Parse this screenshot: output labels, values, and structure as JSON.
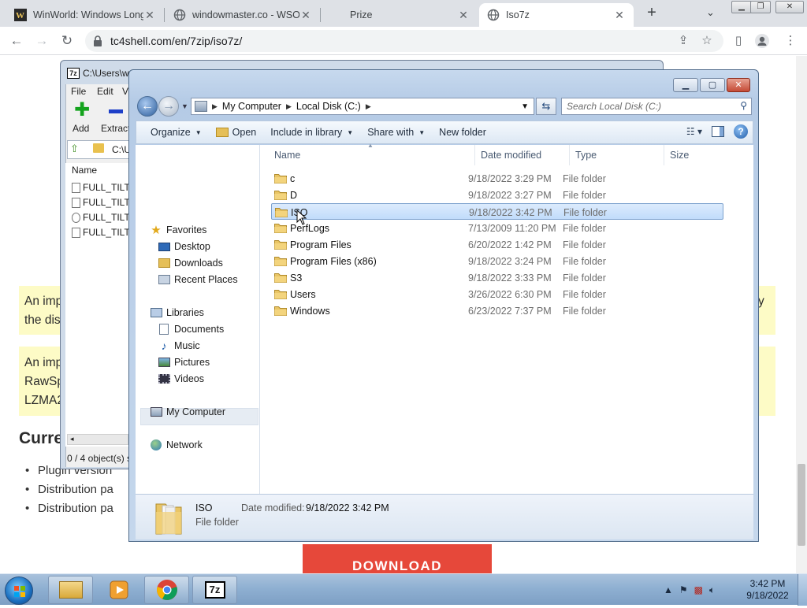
{
  "browser": {
    "tabs": [
      {
        "title": "WinWorld: Windows Long",
        "favicon": "winworld-icon",
        "active": false
      },
      {
        "title": "windowmaster.co - WSO",
        "favicon": "globe-icon",
        "active": false
      },
      {
        "title": "Prize",
        "favicon": "none",
        "active": false
      },
      {
        "title": "Iso7z",
        "favicon": "globe-icon",
        "active": true
      }
    ],
    "url": "tc4shell.com/en/7zip/iso7z/",
    "window_buttons": [
      "minimize",
      "restore",
      "close"
    ]
  },
  "webpage": {
    "note1_line1": "An imp",
    "note1_line1_end": "y",
    "note1_line2": "the dis",
    "note2_line1": "An imp",
    "note2_line2": "RawSp",
    "note2_line3": "LZMA2",
    "heading": "Curre",
    "bullets": [
      "Plugin version",
      "Distribution pa",
      "Distribution pa"
    ],
    "download_label": "DOWNLOAD"
  },
  "sevenzip": {
    "title": "C:\\Users\\w",
    "menu": [
      "File",
      "Edit",
      "V"
    ],
    "toolbar": {
      "add_label": "Add",
      "extract_label": "Extract"
    },
    "path": "C:\\U",
    "column_name": "Name",
    "files": [
      "FULL_TILT",
      "FULL_TILT",
      "FULL_TILT",
      "FULL_TILT"
    ],
    "status": "0 / 4 object(s) s"
  },
  "explorer": {
    "breadcrumb": [
      "My Computer",
      "Local Disk (C:)"
    ],
    "search_placeholder": "Search Local Disk (C:)",
    "commands": {
      "organize": "Organize",
      "open": "Open",
      "include": "Include in library",
      "share": "Share with",
      "newfolder": "New folder"
    },
    "nav": {
      "favorites": "Favorites",
      "desktop": "Desktop",
      "downloads": "Downloads",
      "recent": "Recent Places",
      "libraries": "Libraries",
      "documents": "Documents",
      "music": "Music",
      "pictures": "Pictures",
      "videos": "Videos",
      "mycomputer": "My Computer",
      "network": "Network"
    },
    "columns": {
      "name": "Name",
      "date": "Date modified",
      "type": "Type",
      "size": "Size"
    },
    "files": [
      {
        "name": "c",
        "date": "9/18/2022 3:29 PM",
        "type": "File folder"
      },
      {
        "name": "D",
        "date": "9/18/2022 3:27 PM",
        "type": "File folder"
      },
      {
        "name": "ISO",
        "date": "9/18/2022 3:42 PM",
        "type": "File folder"
      },
      {
        "name": "PerfLogs",
        "date": "7/13/2009 11:20 PM",
        "type": "File folder"
      },
      {
        "name": "Program Files",
        "date": "6/20/2022 1:42 PM",
        "type": "File folder"
      },
      {
        "name": "Program Files (x86)",
        "date": "9/18/2022 3:24 PM",
        "type": "File folder"
      },
      {
        "name": "S3",
        "date": "9/18/2022 3:33 PM",
        "type": "File folder"
      },
      {
        "name": "Users",
        "date": "3/26/2022 6:30 PM",
        "type": "File folder"
      },
      {
        "name": "Windows",
        "date": "6/23/2022 7:37 PM",
        "type": "File folder"
      }
    ],
    "selected_index": 2,
    "details": {
      "name": "ISO",
      "type": "File folder",
      "date_label": "Date modified:",
      "date": "9/18/2022 3:42 PM"
    }
  },
  "taskbar": {
    "apps": [
      "windows-explorer",
      "media-player",
      "chrome",
      "7-zip"
    ],
    "clock_time": "3:42 PM",
    "clock_date": "9/18/2022"
  },
  "colors": {
    "accent_red": "#e6483a",
    "highlight_yellow": "#fdfbc6",
    "selection_blue": "#c1dcfb"
  }
}
